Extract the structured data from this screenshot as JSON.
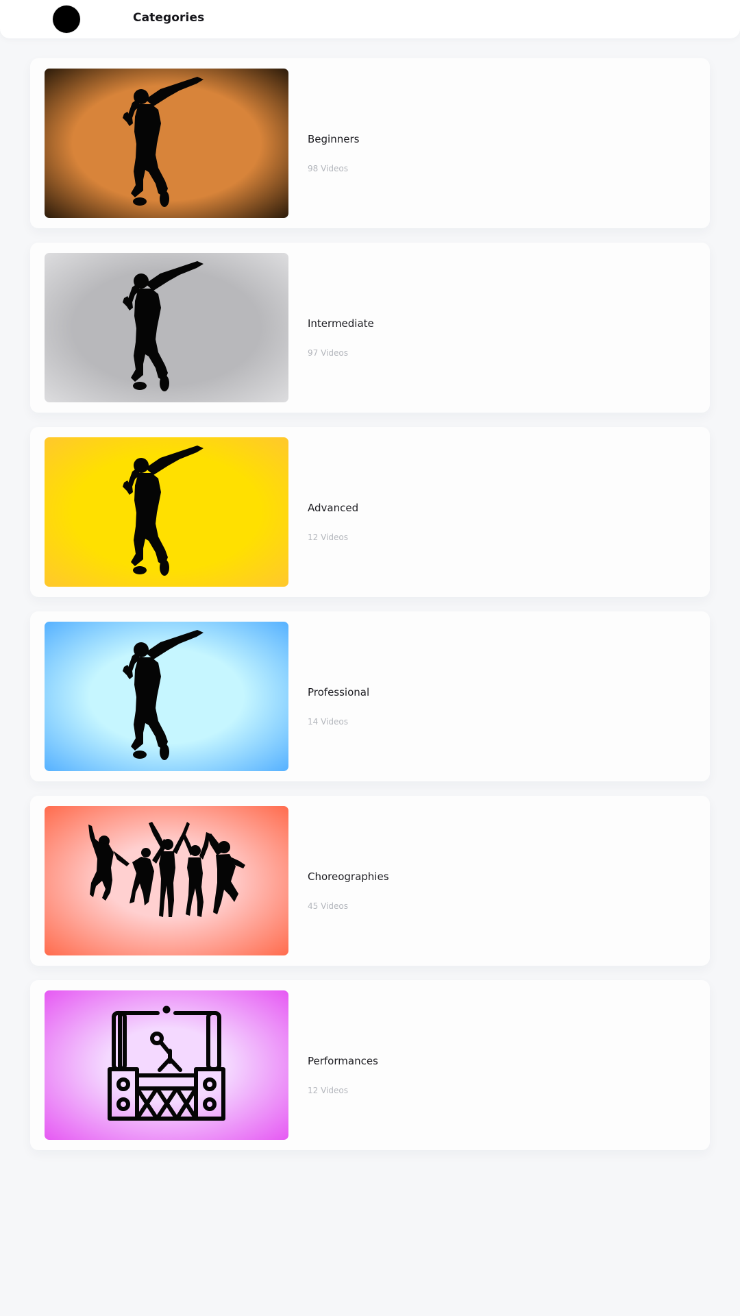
{
  "header": {
    "title": "Categories",
    "avatar_icon": "profile-avatar"
  },
  "categories": [
    {
      "title": "Beginners",
      "count": "98 Videos",
      "icon": "solo-dancer-silhouette-icon",
      "bg_inner": "#d8843a",
      "bg_outer": "#2f1d0b"
    },
    {
      "title": "Intermediate",
      "count": "97 Videos",
      "icon": "solo-dancer-silhouette-icon",
      "bg_inner": "#b8b8bb",
      "bg_outer": "#dcdcde"
    },
    {
      "title": "Advanced",
      "count": "12 Videos",
      "icon": "solo-dancer-silhouette-icon",
      "bg_inner": "#ffe000",
      "bg_outer": "#ffc82c"
    },
    {
      "title": "Professional",
      "count": "14 Videos",
      "icon": "solo-dancer-silhouette-icon",
      "bg_inner": "#c6f6ff",
      "bg_outer": "#58b2ff"
    },
    {
      "title": "Choreographies",
      "count": "45 Videos",
      "icon": "dance-group-silhouette-icon",
      "bg_inner": "#ffd0d0",
      "bg_outer": "#ff6d4f"
    },
    {
      "title": "Performances",
      "count": "12 Videos",
      "icon": "stage-performance-icon",
      "bg_inner": "#f4d9ff",
      "bg_outer": "#e65bf3"
    }
  ]
}
